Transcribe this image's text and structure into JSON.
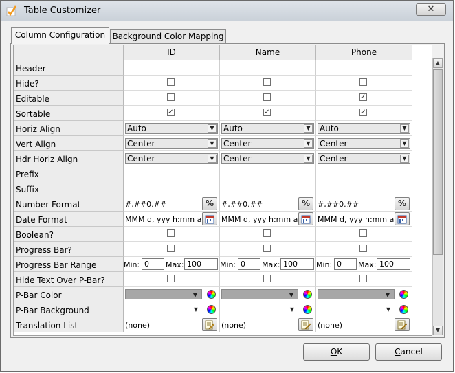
{
  "window": {
    "title": "Table Customizer",
    "close_glyph": "✕",
    "title_icon": "checkmark-icon"
  },
  "tabs": [
    {
      "label": "Column Configuration",
      "active": true
    },
    {
      "label": "Background Color Mapping",
      "active": false
    }
  ],
  "columns": [
    "ID",
    "Name",
    "Phone"
  ],
  "rows": {
    "header": "Header",
    "hide": "Hide?",
    "editable": "Editable",
    "sortable": "Sortable",
    "horiz_align": "Horiz Align",
    "vert_align": "Vert Align",
    "hdr_horiz_align": "Hdr Horiz Align",
    "prefix": "Prefix",
    "suffix": "Suffix",
    "number_format": "Number Format",
    "date_format": "Date Format",
    "boolean": "Boolean?",
    "progress_bar": "Progress Bar?",
    "progress_bar_range": "Progress Bar Range",
    "hide_text_pbar": "Hide Text Over P-Bar?",
    "pbar_color": "P-Bar Color",
    "pbar_background": "P-Bar Background",
    "translation_list": "Translation List"
  },
  "cells": [
    {
      "hide": false,
      "editable": false,
      "sortable": true,
      "horiz_align": "Auto",
      "vert_align": "Center",
      "hdr_horiz_align": "Center",
      "number_format": "#,##0.##",
      "date_format": "MMM d, yyy h:mm a",
      "boolean": false,
      "progress_bar": false,
      "min_label": "Min:",
      "min": "0",
      "max_label": "Max:",
      "max": "100",
      "hide_text_pbar": false,
      "translation": "(none)"
    },
    {
      "hide": false,
      "editable": false,
      "sortable": true,
      "horiz_align": "Auto",
      "vert_align": "Center",
      "hdr_horiz_align": "Center",
      "number_format": "#,##0.##",
      "date_format": "MMM d, yyy h:mm a",
      "boolean": false,
      "progress_bar": false,
      "min_label": "Min:",
      "min": "0",
      "max_label": "Max:",
      "max": "100",
      "hide_text_pbar": false,
      "translation": "(none)"
    },
    {
      "hide": false,
      "editable": true,
      "sortable": true,
      "horiz_align": "Auto",
      "vert_align": "Center",
      "hdr_horiz_align": "Center",
      "number_format": "#,##0.##",
      "date_format": "MMM d, yyy h:mm a",
      "boolean": false,
      "progress_bar": false,
      "min_label": "Min:",
      "min": "0",
      "max_label": "Max:",
      "max": "100",
      "hide_text_pbar": false,
      "translation": "(none)"
    }
  ],
  "icons": {
    "percent": "%",
    "checkmark": "✓",
    "dropdown": "▼",
    "scroll_up": "▲",
    "scroll_down": "▼"
  },
  "colors": {
    "pbar_color_swatch": "#a7a7a7",
    "pbar_background_swatch": "#ffffff",
    "accent": "#f39a1e"
  },
  "buttons": {
    "ok_underlined": "O",
    "ok_rest": "K",
    "cancel_underlined": "C",
    "cancel_rest": "ancel"
  }
}
